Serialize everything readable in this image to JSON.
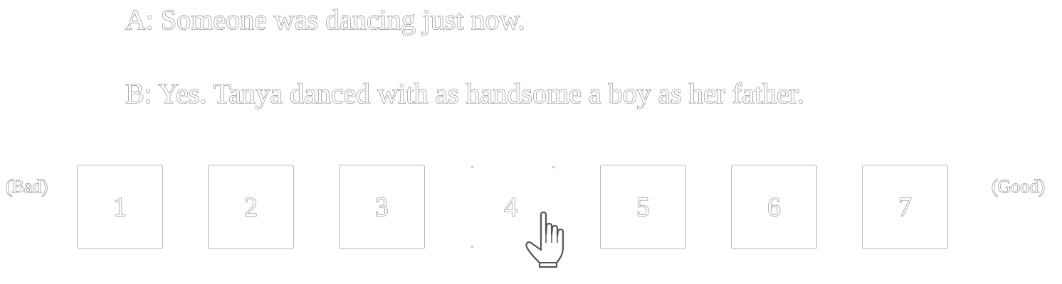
{
  "dialogue": {
    "line_a": "A: Someone was dancing just now.",
    "line_b": "B: Yes. Tanya danced with as handsome a boy as her father."
  },
  "scale": {
    "low_label": "(Bad)",
    "high_label": "(Good)",
    "options": [
      "1",
      "2",
      "3",
      "4",
      "5",
      "6",
      "7"
    ],
    "hovered_option": "4"
  },
  "cursor": {
    "icon": "hand-pointer-icon"
  },
  "colors": {
    "text_outline": "#6e6e6e",
    "box_border": "#b5b5b5",
    "background": "#ffffff"
  }
}
